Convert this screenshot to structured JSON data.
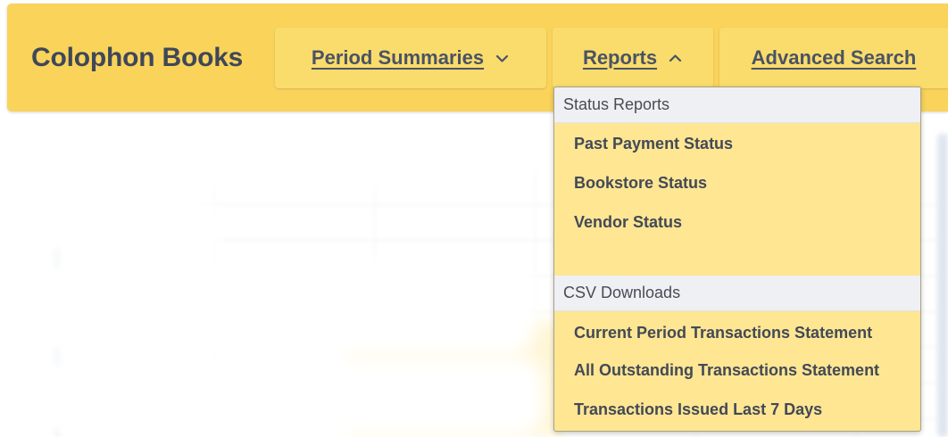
{
  "brand": {
    "name": "Colophon Books"
  },
  "nav": {
    "items": [
      {
        "label": "Period Summaries",
        "caret": "chevron-down-icon"
      },
      {
        "label": "Reports",
        "caret": "chevron-up-icon"
      },
      {
        "label": "Advanced Search"
      }
    ]
  },
  "dropdown": {
    "sections": [
      {
        "header": "Status Reports",
        "items": [
          "Past Payment Status",
          "Bookstore Status",
          "Vendor Status"
        ]
      },
      {
        "header": "CSV Downloads",
        "items": [
          "Current Period Transactions Statement",
          "All Outstanding Transactions Statement",
          "Transactions Issued Last 7 Days"
        ]
      }
    ]
  },
  "colors": {
    "navbar_bg": "#f9d35a",
    "nav_item_bg": "#fadc6c",
    "dropdown_bg": "#fee693",
    "header_bg": "#eef0f3",
    "text_dark": "#3f4758"
  }
}
